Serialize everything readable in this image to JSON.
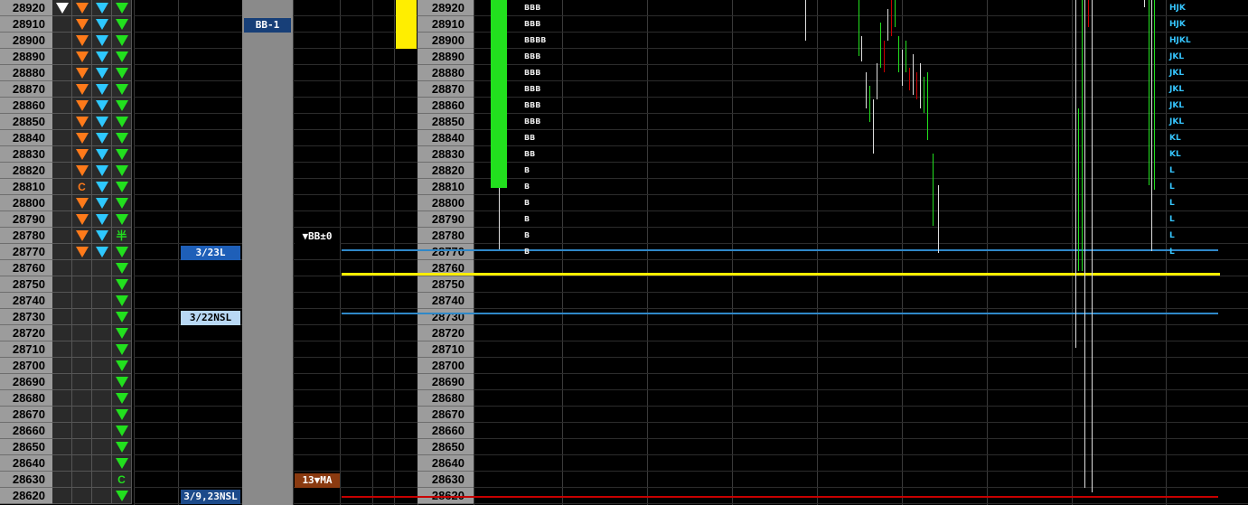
{
  "prices": [
    "28920",
    "28910",
    "28900",
    "28890",
    "28880",
    "28870",
    "28860",
    "28850",
    "28840",
    "28830",
    "28820",
    "28810",
    "28800",
    "28790",
    "28780",
    "28770",
    "28760",
    "28750",
    "28740",
    "28730",
    "28720",
    "28710",
    "28700",
    "28690",
    "28680",
    "28670",
    "28660",
    "28650",
    "28640",
    "28630",
    "28620"
  ],
  "signals": {
    "col1": [
      "white-down",
      "",
      "",
      "",
      "",
      "",
      "",
      "",
      "",
      "",
      "",
      "",
      "",
      "",
      "",
      "",
      "",
      "",
      "",
      "",
      "",
      "",
      "",
      "",
      "",
      "",
      "",
      "",
      "",
      "",
      ""
    ],
    "col2": [
      "orange-down",
      "orange-down",
      "orange-down",
      "orange-down",
      "orange-down",
      "orange-down",
      "orange-down",
      "orange-down",
      "orange-down",
      "orange-down",
      "orange-down",
      "C",
      "orange-down",
      "orange-down",
      "orange-down",
      "orange-down",
      "",
      "",
      "",
      "",
      "",
      "",
      "",
      "",
      "",
      "",
      "",
      "",
      "",
      "",
      ""
    ],
    "col3": [
      "cyan-down",
      "cyan-down",
      "cyan-down",
      "cyan-down",
      "cyan-down",
      "cyan-down",
      "cyan-down",
      "cyan-down",
      "cyan-down",
      "cyan-down",
      "cyan-down",
      "cyan-down",
      "cyan-down",
      "cyan-down",
      "cyan-down",
      "cyan-down",
      "",
      "",
      "",
      "",
      "",
      "",
      "",
      "",
      "",
      "",
      "",
      "",
      "",
      "",
      ""
    ],
    "col4": [
      "green-down",
      "green-down",
      "green-down",
      "green-down",
      "green-down",
      "green-down",
      "green-down",
      "green-down",
      "green-down",
      "green-down",
      "green-down",
      "green-down",
      "green-down",
      "green-down",
      "半",
      "green-down",
      "green-down",
      "green-down",
      "green-down",
      "green-down",
      "green-down",
      "green-down",
      "green-down",
      "green-down",
      "green-down",
      "green-down",
      "green-down",
      "green-down",
      "green-down",
      "C",
      "green-down"
    ]
  },
  "signal_colors": {
    "white": "#ffffff",
    "orange": "#ff7a1a",
    "cyan": "#2ec8ff",
    "green": "#22e01e",
    "C_orange": "#ff7a1a",
    "C_green": "#22e01e"
  },
  "tags": {
    "bb_minus_1": "BB-1",
    "bb_pm0": "▼BB±0",
    "date_323l": "3/23L",
    "date_322nsl": "3/22NSL",
    "sma13": "13▼MA",
    "date_39_23nsl": "3/9,23NSL"
  },
  "tpo_profile": [
    "BBB",
    "BBB",
    "BBBB",
    "BBB",
    "BBB",
    "BBB",
    "BBB",
    "BBB",
    "BB",
    "BB",
    "B",
    "B",
    "B",
    "B",
    "B",
    "B"
  ],
  "tpo_right": [
    "HJK",
    "HJK",
    "HJKL",
    "JKL",
    "JKL",
    "JKL",
    "JKL",
    "JKL",
    "KL",
    "KL",
    "L",
    "L",
    "L",
    "L",
    "L",
    "L"
  ],
  "lines": {
    "yellow": "#ffee00",
    "blue": "#2f88c8",
    "red": "#c80000"
  }
}
